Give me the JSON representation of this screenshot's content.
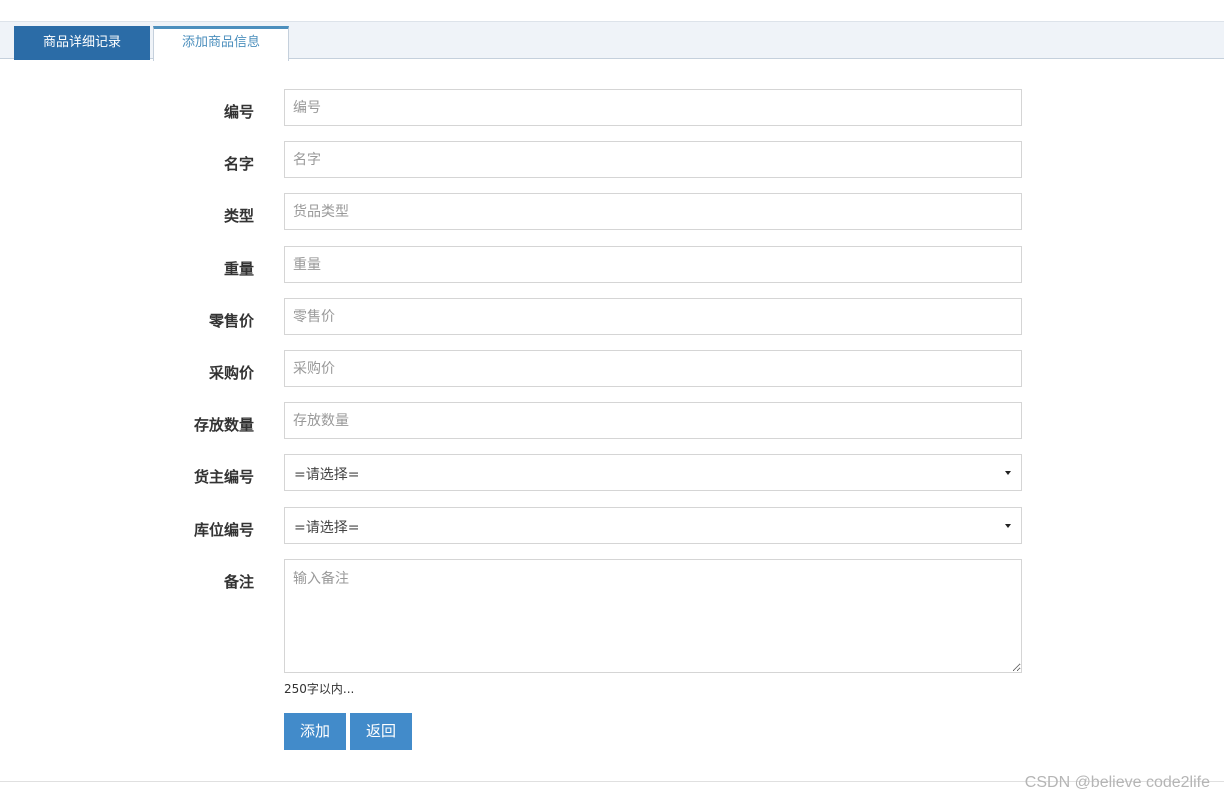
{
  "tabs": [
    {
      "label": "商品详细记录",
      "active": true
    },
    {
      "label": "添加商品信息",
      "active": false
    }
  ],
  "form": {
    "fields": [
      {
        "label": "编号",
        "placeholder": "编号",
        "type": "text"
      },
      {
        "label": "名字",
        "placeholder": "名字",
        "type": "text"
      },
      {
        "label": "类型",
        "placeholder": "货品类型",
        "type": "text"
      },
      {
        "label": "重量",
        "placeholder": "重量",
        "type": "text"
      },
      {
        "label": "零售价",
        "placeholder": "零售价",
        "type": "text"
      },
      {
        "label": "采购价",
        "placeholder": "采购价",
        "type": "text"
      },
      {
        "label": "存放数量",
        "placeholder": "存放数量",
        "type": "text"
      },
      {
        "label": "货主编号",
        "value": "=请选择=",
        "type": "select"
      },
      {
        "label": "库位编号",
        "value": "=请选择=",
        "type": "select"
      },
      {
        "label": "备注",
        "placeholder": "输入备注",
        "type": "textarea"
      }
    ],
    "textarea_hint": "250字以内...",
    "add_label": "添加",
    "back_label": "返回"
  },
  "watermark": "CSDN @believe code2life",
  "colors": {
    "primary": "#428bca",
    "tab_dark": "#2b6ca7",
    "tab_link": "#4c8fbd",
    "tabbar_bg": "#eff3f8"
  }
}
